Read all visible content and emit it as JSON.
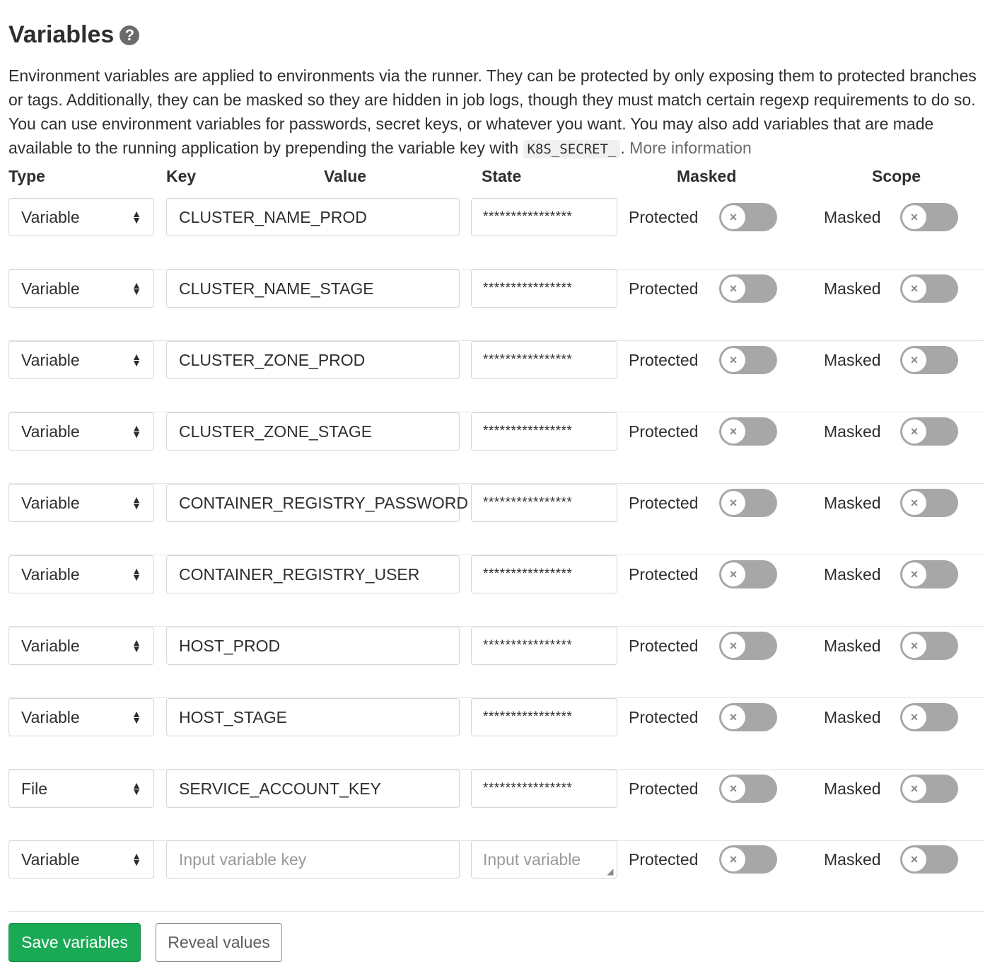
{
  "section": {
    "title": "Variables",
    "help_icon": "question-circle-icon",
    "description": "Environment variables are applied to environments via the runner. They can be protected by only exposing them to protected branches or tags. Additionally, they can be masked so they are hidden in job logs, though they must match certain regexp requirements to do so. You can use environment variables for passwords, secret keys, or whatever you want. You may also add variables that are made available to the running application by prepending the variable key with",
    "code": "K8S_SECRET_",
    "period": ".",
    "more_info": "More information"
  },
  "headers": {
    "type": "Type",
    "key": "Key",
    "value": "Value",
    "state": "State",
    "masked": "Masked",
    "scope": "Scope"
  },
  "rows": [
    {
      "type": "Variable",
      "key": "CLUSTER_NAME_PROD",
      "value": "****************",
      "protected_label": "Protected",
      "masked_label": "Masked"
    },
    {
      "type": "Variable",
      "key": "CLUSTER_NAME_STAGE",
      "value": "****************",
      "protected_label": "Protected",
      "masked_label": "Masked"
    },
    {
      "type": "Variable",
      "key": "CLUSTER_ZONE_PROD",
      "value": "****************",
      "protected_label": "Protected",
      "masked_label": "Masked"
    },
    {
      "type": "Variable",
      "key": "CLUSTER_ZONE_STAGE",
      "value": "****************",
      "protected_label": "Protected",
      "masked_label": "Masked"
    },
    {
      "type": "Variable",
      "key": "CONTAINER_REGISTRY_PASSWORD",
      "value": "****************",
      "protected_label": "Protected",
      "masked_label": "Masked"
    },
    {
      "type": "Variable",
      "key": "CONTAINER_REGISTRY_USER",
      "value": "****************",
      "protected_label": "Protected",
      "masked_label": "Masked"
    },
    {
      "type": "Variable",
      "key": "HOST_PROD",
      "value": "****************",
      "protected_label": "Protected",
      "masked_label": "Masked"
    },
    {
      "type": "Variable",
      "key": "HOST_STAGE",
      "value": "****************",
      "protected_label": "Protected",
      "masked_label": "Masked"
    },
    {
      "type": "File",
      "key": "SERVICE_ACCOUNT_KEY",
      "value": "****************",
      "protected_label": "Protected",
      "masked_label": "Masked"
    }
  ],
  "new_row": {
    "type": "Variable",
    "key_placeholder": "Input variable key",
    "value_placeholder": "Input variable",
    "protected_label": "Protected",
    "masked_label": "Masked"
  },
  "toggles": {
    "protected": false,
    "masked": false,
    "off_icon": "close-icon"
  },
  "buttons": {
    "save": "Save variables",
    "reveal": "Reveal values"
  },
  "colors": {
    "save_button": "#1aaa55",
    "toggle_off": "#a7a7a7"
  }
}
